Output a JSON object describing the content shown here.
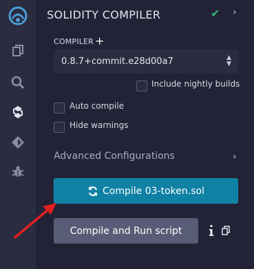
{
  "sidebar": {
    "icons": [
      "remix-logo-icon",
      "file-explorer-icon",
      "search-icon",
      "solidity-compiler-icon",
      "deploy-run-icon",
      "debugger-icon"
    ]
  },
  "panel": {
    "title": "SOLIDITY COMPILER",
    "compiler_label": "COMPILER",
    "compiler_version": "0.8.7+commit.e28d00a7",
    "include_nightly_label": "Include nightly builds",
    "auto_compile_label": "Auto compile",
    "hide_warnings_label": "Hide warnings",
    "advanced_label": "Advanced Configurations",
    "compile_button_label": "Compile 03-token.sol",
    "run_script_button_label": "Compile and Run script"
  },
  "colors": {
    "accent": "#0f81a4",
    "success": "#2fb67b",
    "annotation_arrow": "#e02020"
  }
}
